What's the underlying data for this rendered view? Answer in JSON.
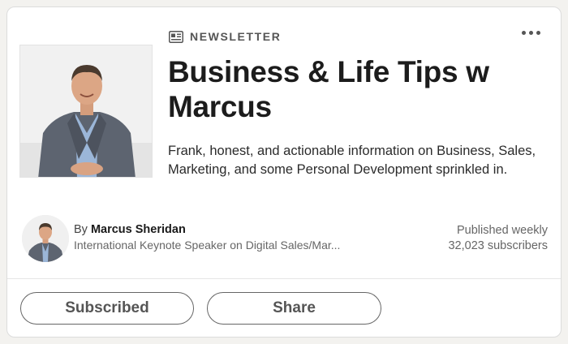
{
  "newsletter": {
    "type_label": "NEWSLETTER",
    "title": "Business & Life Tips w Marcus",
    "description": "Frank, honest, and actionable information on Business, Sales, Marketing, and some Personal Development sprinkled in."
  },
  "author": {
    "by_prefix": "By",
    "name": "Marcus Sheridan",
    "headline": "International Keynote Speaker on Digital Sales/Mar..."
  },
  "meta": {
    "frequency": "Published weekly",
    "subscribers": "32,023 subscribers"
  },
  "actions": {
    "subscribed_label": "Subscribed",
    "share_label": "Share"
  },
  "icons": {
    "menu": "more-horizontal-icon",
    "type": "newsletter-icon"
  },
  "colors": {
    "text_primary": "#191919",
    "text_secondary": "#666666",
    "button_border": "#666666",
    "page_background": "#f3f2ef"
  }
}
